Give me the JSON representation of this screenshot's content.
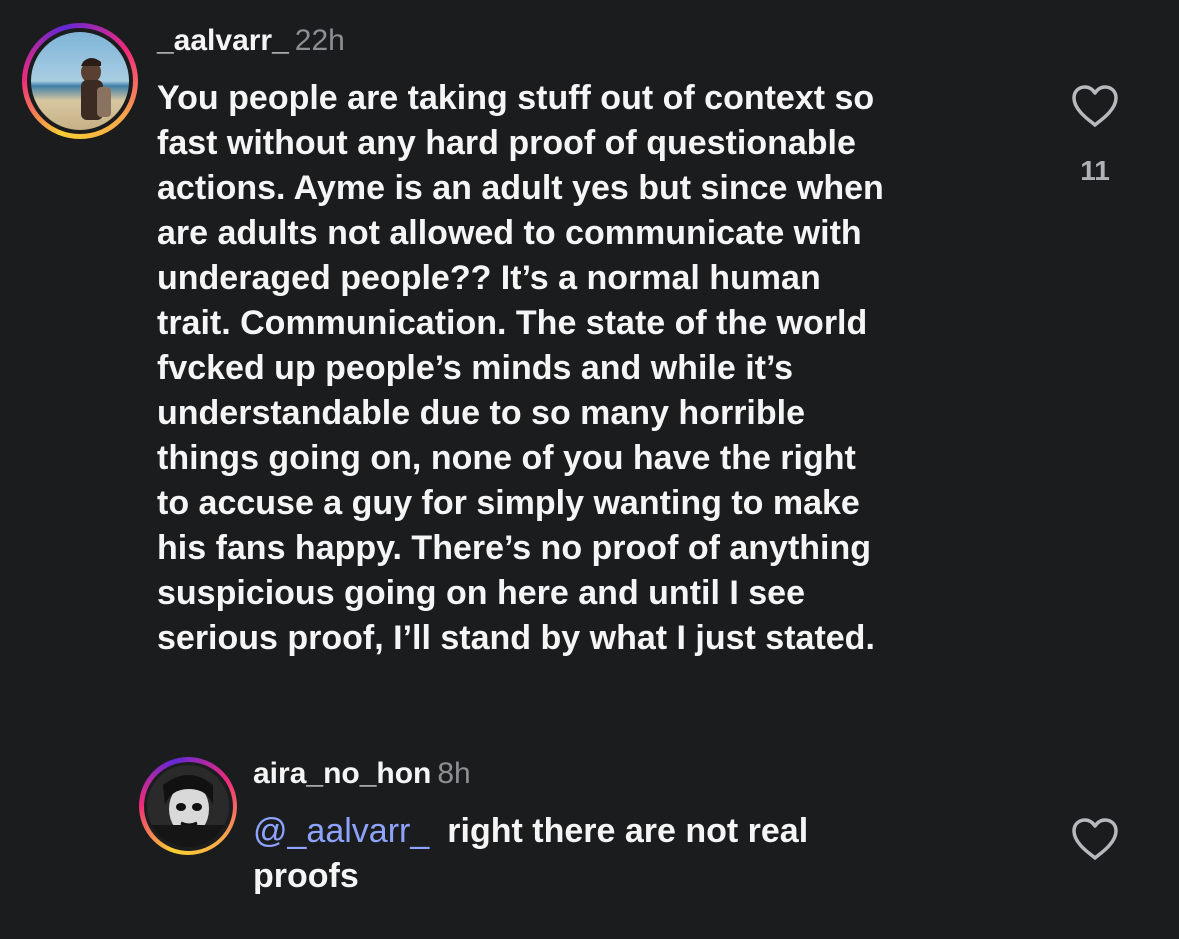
{
  "comments": [
    {
      "username": "_aalvarr_",
      "time": "22h",
      "lines": [
        "You people are taking stuff out of context so",
        "fast without any hard proof of questionable",
        "actions. Ayme is an adult yes but since when",
        "are adults not allowed to communicate with",
        "underaged people?? It’s a normal human",
        "trait. Communication. The state of the world",
        "fvcked up people’s minds and while it’s",
        "understandable due to so many horrible",
        "things going on, none of you have the right",
        "to accuse a guy for simply wanting to make",
        "his fans happy. There’s no proof of anything",
        "suspicious going on here and until I see",
        "serious proof, I’ll stand by what I just stated."
      ],
      "like_count": "11",
      "like_icon": "heart-outline-icon"
    },
    {
      "username": "aira_no_hon",
      "time": "8h",
      "mention": "@_aalvarr_",
      "text_first_line": "right there are not real",
      "text_second_line": "proofs",
      "like_icon": "heart-outline-icon"
    }
  ],
  "colors": {
    "background": "#1b1c1e",
    "text": "#f5f5f5",
    "secondary_text": "#8e8e93",
    "mention": "#8ea3ff"
  }
}
